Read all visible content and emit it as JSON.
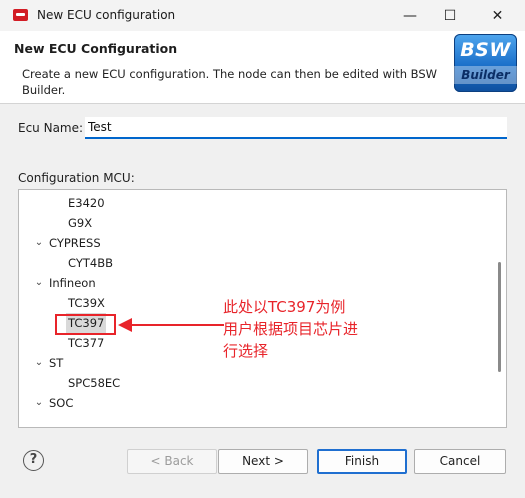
{
  "window": {
    "title": "New ECU configuration",
    "controls": {
      "minimize": "—",
      "maximize": "☐",
      "close": "✕"
    }
  },
  "header": {
    "title": "New ECU Configuration",
    "description": "Create a new ECU configuration. The node can then be edited with BSW Builder.",
    "logo": {
      "line1": "BSW",
      "line2": "Builder"
    }
  },
  "form": {
    "ecu_name_label": "Ecu Name:",
    "ecu_name_value": "Test",
    "mcu_label": "Configuration MCU:"
  },
  "tree": {
    "rows": [
      {
        "label": "E3420",
        "level": 1,
        "expandable": false
      },
      {
        "label": "G9X",
        "level": 1,
        "expandable": false
      },
      {
        "label": "CYPRESS",
        "level": 0,
        "expandable": true,
        "arrow": "⌄"
      },
      {
        "label": "CYT4BB",
        "level": 1,
        "expandable": false
      },
      {
        "label": "Infineon",
        "level": 0,
        "expandable": true,
        "arrow": "⌄"
      },
      {
        "label": "TC39X",
        "level": 1,
        "expandable": false
      },
      {
        "label": "TC397",
        "level": 1,
        "expandable": false,
        "selected": true
      },
      {
        "label": "TC377",
        "level": 1,
        "expandable": false
      },
      {
        "label": "ST",
        "level": 0,
        "expandable": true,
        "arrow": "⌄"
      },
      {
        "label": "SPC58EC",
        "level": 1,
        "expandable": false
      },
      {
        "label": "SOC",
        "level": 0,
        "expandable": true,
        "arrow": "⌄"
      }
    ]
  },
  "annotation": {
    "lines": [
      "此处以TC397为例",
      "用户根据项目芯片进",
      "行选择"
    ],
    "color": "#e8242a"
  },
  "buttons": {
    "help": "?",
    "back": "< Back",
    "next": "Next >",
    "finish": "Finish",
    "cancel": "Cancel"
  }
}
